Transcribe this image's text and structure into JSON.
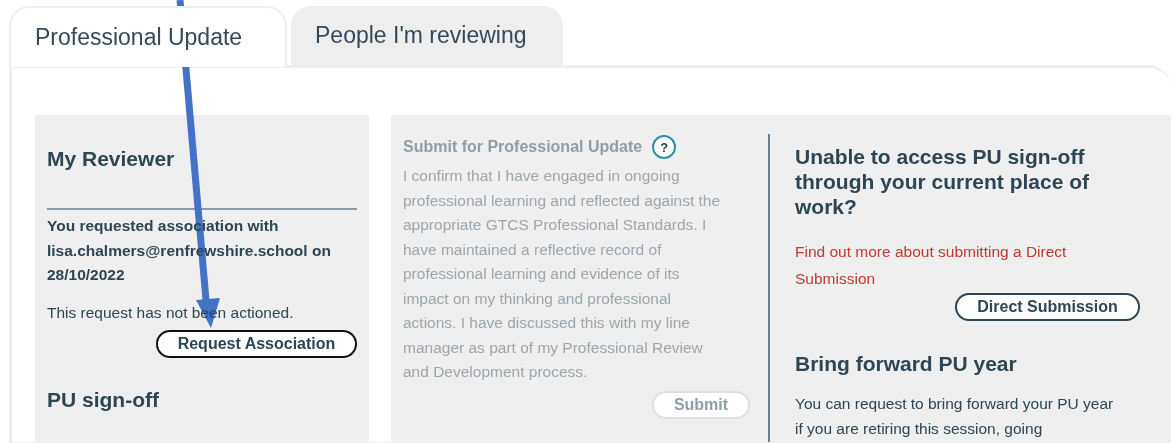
{
  "tabs": [
    {
      "label": "Professional Update",
      "selected": true
    },
    {
      "label": "People I'm reviewing",
      "selected": false
    }
  ],
  "my_reviewer": {
    "title": "My Reviewer",
    "request_text": "You requested association with lisa.chalmers@renfrewshire.school on 28/10/2022",
    "status_text": "This request has not been actioned.",
    "button": "Request Association"
  },
  "pu_signoff": {
    "title": "PU sign-off"
  },
  "submit_panel": {
    "title": "Submit for Professional Update",
    "help_icon": "?",
    "body": "I confirm that I have engaged in ongoing professional learning and reflected against the appropriate GTCS Professional Standards. I have maintained a reflective record of professional learning and evidence of its impact on my thinking and professional actions. I have discussed this with my line manager as part of my Professional Review and Development process.",
    "submit_button": {
      "label": "Submit",
      "disabled": true
    }
  },
  "direct_submission": {
    "title": "Unable to access PU sign-off through your current place of work?",
    "link": "Find out more about submitting a Direct Submission",
    "button": "Direct Submission"
  },
  "bring_forward": {
    "title": "Bring forward PU year",
    "body": "You can request to bring forward your PU year if you are retiring this session, going"
  },
  "annotation": {
    "kind": "arrow"
  }
}
